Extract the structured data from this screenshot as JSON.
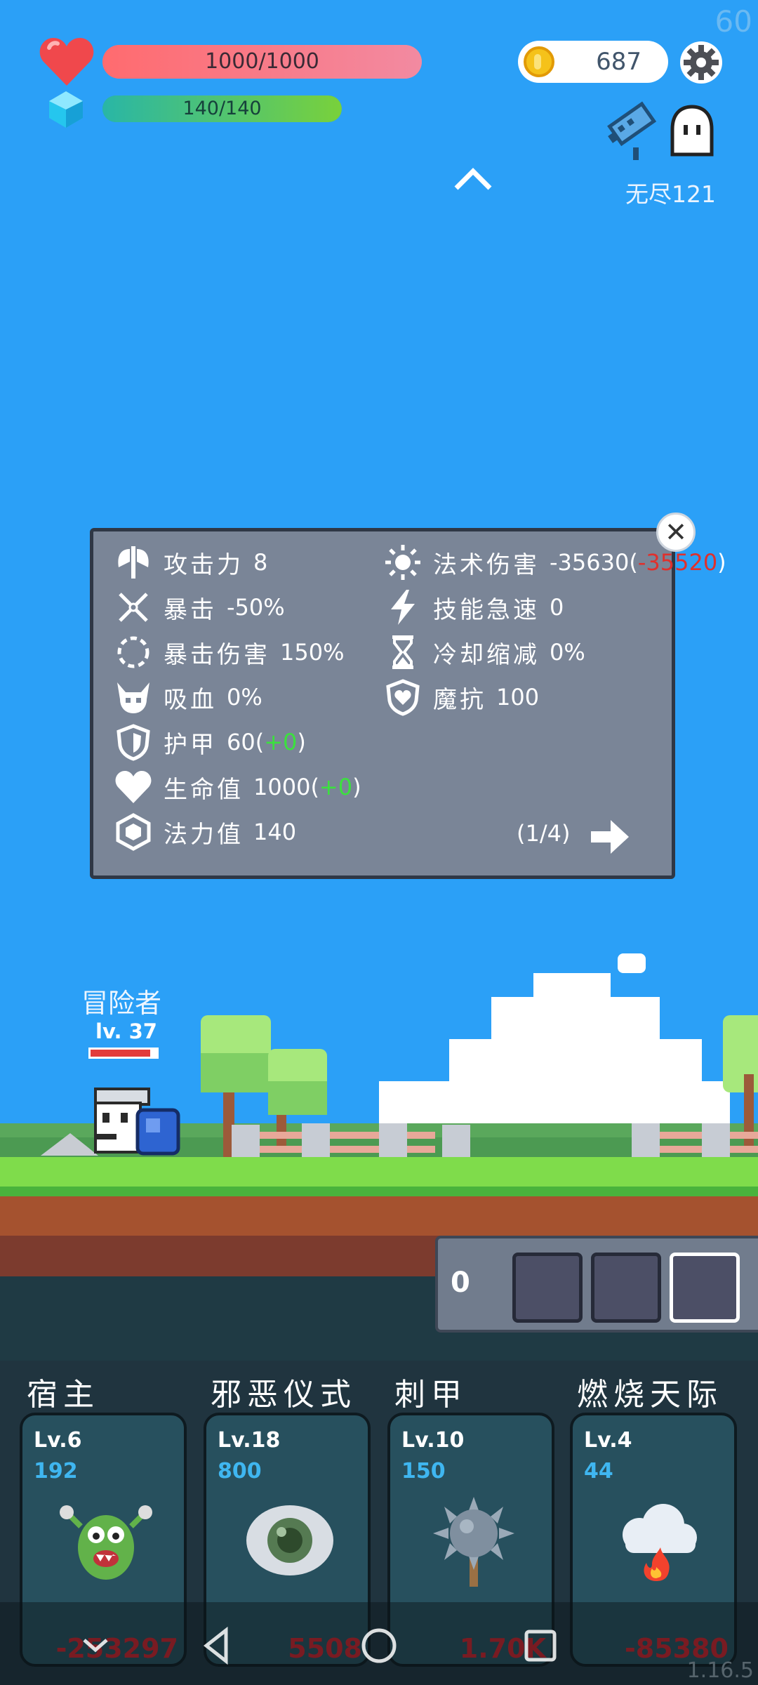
{
  "fps": "60",
  "version": "1.16.5",
  "hud": {
    "hp_text": "1000/1000",
    "hp_ratio": 1.0,
    "mp_text": "140/140",
    "mp_ratio": 1.0,
    "coins": "687",
    "mode": "无尽121"
  },
  "stats_panel": {
    "left": [
      {
        "icon": "axe-icon",
        "label": "攻击力",
        "value": "8"
      },
      {
        "icon": "crossed-swords-icon",
        "label": "暴击",
        "value": "-50%"
      },
      {
        "icon": "crit-damage-icon",
        "label": "暴击伤害",
        "value": "150%"
      },
      {
        "icon": "vampire-skull-icon",
        "label": "吸血",
        "value": "0%"
      },
      {
        "icon": "armor-shield-icon",
        "label": "护甲",
        "value": "60",
        "paren_open": "(",
        "bonus": "+0",
        "paren_close": ")"
      },
      {
        "icon": "heart-icon",
        "label": "生命值",
        "value": "1000",
        "paren_open": "(",
        "bonus": "+0",
        "paren_close": ")"
      },
      {
        "icon": "mana-crystal-icon",
        "label": "法力值",
        "value": "140"
      }
    ],
    "right": [
      {
        "icon": "sun-icon",
        "label": "法术伤害",
        "value": "-35630",
        "paren_open": "(",
        "bonus": "-35520",
        "paren_close": ")"
      },
      {
        "icon": "lightning-icon",
        "label": "技能急速",
        "value": "0"
      },
      {
        "icon": "hourglass-icon",
        "label": "冷却缩减",
        "value": "0%"
      },
      {
        "icon": "magic-shield-icon",
        "label": "魔抗",
        "value": "100"
      }
    ],
    "page": "(1/4)",
    "close_symbol": "✕"
  },
  "hero": {
    "name": "冒险者",
    "level": "lv. 37",
    "hp_ratio": 0.9
  },
  "skill_slots": {
    "count": "0"
  },
  "cards": [
    {
      "title": "宿主",
      "level": "Lv.6",
      "cost": "192",
      "damage": "-253297",
      "art": "green-monster-icon"
    },
    {
      "title": "邪恶仪式",
      "level": "Lv.18",
      "cost": "800",
      "damage": "5508",
      "art": "eye-icon"
    },
    {
      "title": "刺甲",
      "level": "Lv.10",
      "cost": "150",
      "damage": "1.70K",
      "art": "spiked-mace-icon"
    },
    {
      "title": "燃烧天际",
      "level": "Lv.4",
      "cost": "44",
      "damage": "-85380",
      "art": "fire-cloud-icon"
    }
  ],
  "colors": {
    "sky": "#2ba0f7",
    "hp": "#ff6b6f",
    "mp": "#79d13b",
    "coin": "#f5c21a",
    "panel": "#7a8597",
    "bonus_positive": "#3be13e",
    "bonus_negative": "#e0302c",
    "card_cost": "#3fb6f0",
    "card_damage": "#d4222a"
  }
}
